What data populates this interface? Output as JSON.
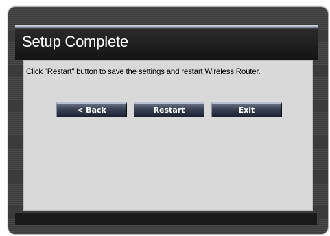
{
  "title": "Setup Complete",
  "message": "Click \"Restart\" button to save the settings and restart Wireless Router.",
  "buttons": {
    "back": "< Back",
    "restart": "Restart",
    "exit": "Exit"
  },
  "colors": {
    "title_bar": "#141414",
    "content_bg": "#d9d9d9",
    "button_gradient_top": "#6a7386",
    "button_gradient_bottom": "#1d2230"
  }
}
